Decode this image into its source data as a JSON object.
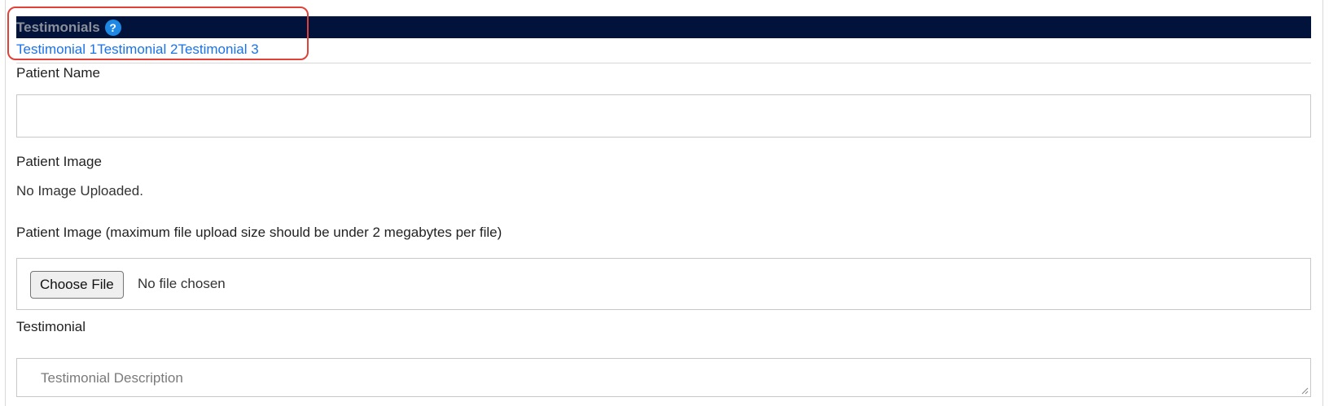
{
  "section": {
    "title": "Testimonials",
    "help_icon": "question-circle-icon",
    "help_glyph": "?",
    "tabs": [
      "Testimonial 1",
      "Testimonial 2",
      "Testimonial 3"
    ]
  },
  "form": {
    "patient_name_label": "Patient Name",
    "patient_name_value": "",
    "patient_image_label": "Patient Image",
    "patient_image_status": "No Image Uploaded.",
    "patient_image_upload_label": "Patient Image (maximum file upload size should be under 2 megabytes per file)",
    "choose_file_label": "Choose File",
    "file_status": "No file chosen",
    "testimonial_label": "Testimonial",
    "testimonial_placeholder": "Testimonial Description"
  },
  "colors": {
    "header_bg": "#02133b",
    "link": "#1a73e8",
    "highlight": "#e0423a",
    "help_icon_bg": "#1e88e5"
  }
}
